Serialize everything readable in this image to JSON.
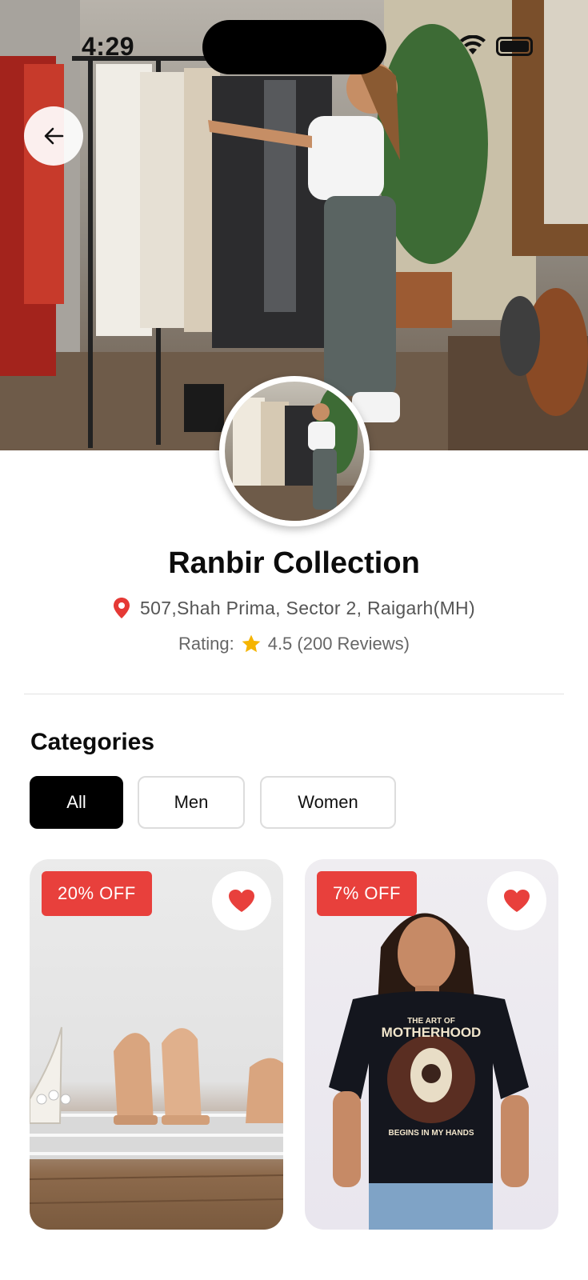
{
  "status_bar": {
    "time": "4:29"
  },
  "header": {
    "back_icon": "arrow-left-icon"
  },
  "store": {
    "name": "Ranbir Collection",
    "address": "507,Shah Prima, Sector 2, Raigarh(MH)",
    "rating_label": "Rating:",
    "rating_value": "4.5 (200 Reviews)",
    "rating": 4.5,
    "review_count": 200
  },
  "categories": {
    "title": "Categories",
    "chips": [
      {
        "label": "All",
        "active": true
      },
      {
        "label": "Men",
        "active": false
      },
      {
        "label": "Women",
        "active": false
      }
    ]
  },
  "products": [
    {
      "discount": "20% OFF",
      "favorite": true,
      "image": "gold-heels-photo"
    },
    {
      "discount": "7% OFF",
      "favorite": true,
      "image": "black-tshirt-photo",
      "shirt_print": [
        "THE ART OF",
        "MOTHERHOOD",
        "BEGINS IN MY HANDS"
      ]
    }
  ],
  "colors": {
    "accent_red": "#e8403c",
    "pin_red": "#e53935",
    "star_yellow": "#f5b400",
    "chip_active_bg": "#000000"
  }
}
